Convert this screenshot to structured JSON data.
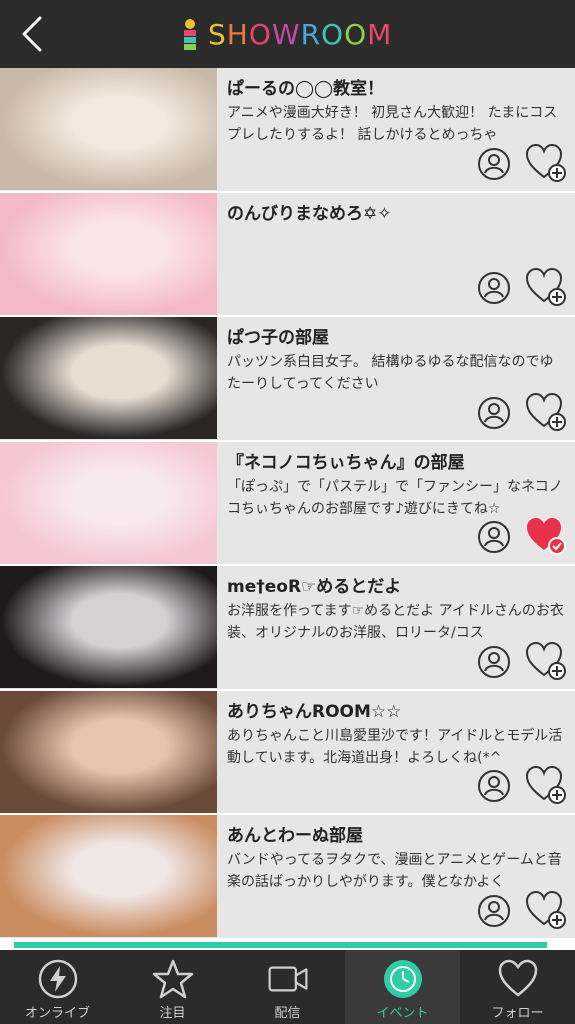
{
  "header": {
    "logo_text": "SHOWROOM",
    "logo_letters": [
      {
        "ch": "S",
        "color": "#e8c230"
      },
      {
        "ch": "H",
        "color": "#ec7a36"
      },
      {
        "ch": "O",
        "color": "#e6466f"
      },
      {
        "ch": "W",
        "color": "#c14aa8"
      },
      {
        "ch": "R",
        "color": "#4da6d8"
      },
      {
        "ch": "O",
        "color": "#44c3b5"
      },
      {
        "ch": "O",
        "color": "#8fce4a"
      },
      {
        "ch": "M",
        "color": "#e6466f"
      }
    ]
  },
  "rooms": [
    {
      "title": "ぱーるの◯◯教室！",
      "desc": "アニメや漫画大好き！ 初見さん大歓迎！ たまにコスプレしたりするよ！ 話しかけるとめっちゃ",
      "favorited": false,
      "thumb_colors": [
        "#c9b9a8",
        "#f2e8df"
      ]
    },
    {
      "title": "のんびりまなめろ✡✧",
      "desc": "",
      "favorited": false,
      "thumb_colors": [
        "#f3b9c9",
        "#fbe3ea"
      ]
    },
    {
      "title": "ぱつ子の部屋",
      "desc": "パッツン系白目女子。 結構ゆるゆるな配信なのでゆたーりしてってください",
      "favorited": false,
      "thumb_colors": [
        "#2a2626",
        "#e9ddd2"
      ]
    },
    {
      "title": "『ネコノコちぃちゃん』の部屋",
      "desc": "「ぽっぷ」で「パステル」で「ファンシー」なネコノコちぃちゃんのお部屋です♪遊びにきてね☆",
      "favorited": true,
      "thumb_colors": [
        "#f5c6d4",
        "#f8e9ef"
      ]
    },
    {
      "title": "me†eoR☞めるとだよ",
      "desc": "お洋服を作ってます☞めるとだよ アイドルさんのお衣装、オリジナルのお洋服、ロリータ/コス",
      "favorited": false,
      "thumb_colors": [
        "#1e1a1c",
        "#d8cfd3"
      ]
    },
    {
      "title": "ありちゃんROOM☆☆",
      "desc": "ありちゃんこと川島愛里沙です！アイドルとモデル活動しています。北海道出身！よろしくね(*^",
      "favorited": false,
      "thumb_colors": [
        "#6b4a3a",
        "#e8c4ae"
      ]
    },
    {
      "title": "あんとわーぬ部屋",
      "desc": "バンドやってるヲタクで、漫画とアニメとゲームと音楽の話ばっかりしやがります。僕となかよく",
      "favorited": false,
      "thumb_colors": [
        "#c98c5f",
        "#f0e6e6"
      ]
    }
  ],
  "progress": 0.975,
  "tabs": [
    {
      "label": "オンライブ",
      "icon": "lightning-icon",
      "active": false
    },
    {
      "label": "注目",
      "icon": "star-icon",
      "active": false
    },
    {
      "label": "配信",
      "icon": "video-camera-icon",
      "active": false
    },
    {
      "label": "イベント",
      "icon": "clock-icon",
      "active": true
    },
    {
      "label": "フォロー",
      "icon": "heart-icon",
      "active": false
    }
  ],
  "colors": {
    "accent": "#2ecda4",
    "favorite": "#e8324a",
    "bar": "#2b2b2b"
  }
}
